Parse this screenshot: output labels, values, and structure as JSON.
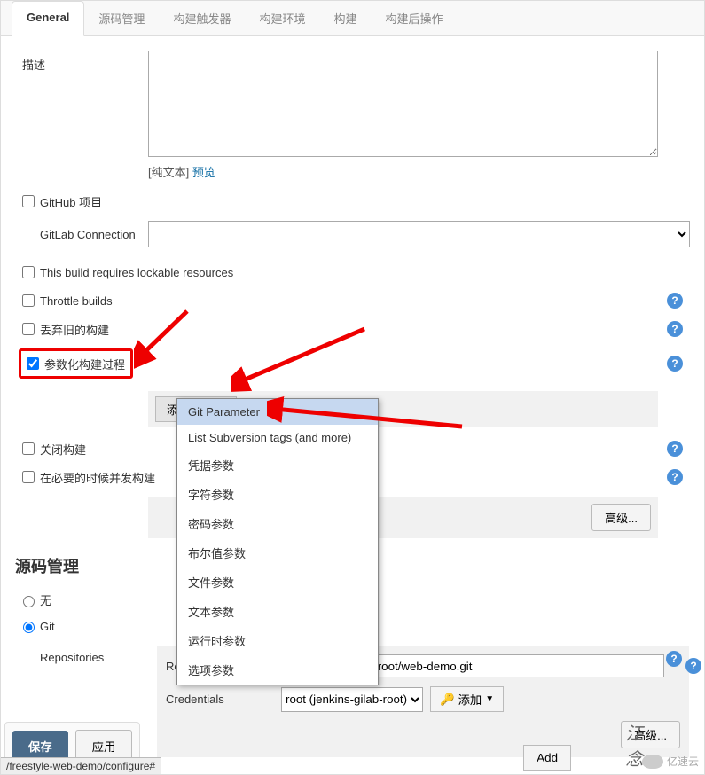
{
  "tabs": {
    "general": "General",
    "scm": "源码管理",
    "triggers": "构建触发器",
    "env": "构建环境",
    "build": "构建",
    "post": "构建后操作"
  },
  "description": {
    "label": "描述",
    "value": "",
    "plaintext": "[纯文本]",
    "preview": "预览"
  },
  "checkboxes": {
    "github_project": "GitHub 项目",
    "gitlab_connection_label": "GitLab Connection",
    "lockable": "This build requires lockable resources",
    "throttle": "Throttle builds",
    "discard_old": "丢弃旧的构建",
    "parametrize": "参数化构建过程",
    "close_build": "关闭构建",
    "concurrent": "在必要的时候并发构建"
  },
  "add_param": {
    "button": "添加参数",
    "items": [
      "Git Parameter",
      "List Subversion tags (and more)",
      "凭据参数",
      "字符参数",
      "密码参数",
      "布尔值参数",
      "文件参数",
      "文本参数",
      "运行时参数",
      "选项参数"
    ]
  },
  "advanced_button": "高级...",
  "scm_section": {
    "title": "源码管理",
    "none": "无",
    "git": "Git",
    "repositories_label": "Repositories",
    "repo_url_label": "Repository URL",
    "repo_url_value": "git@192.168.1.6:root/web-demo.git",
    "credentials_label": "Credentials",
    "credentials_value": "root (jenkins-gilab-root)",
    "add_credential": "添加"
  },
  "footer": {
    "save": "保存",
    "apply": "应用",
    "add": "Add",
    "url": "/freestyle-web-demo/configure#"
  },
  "watermark": {
    "text": "亿速云"
  }
}
